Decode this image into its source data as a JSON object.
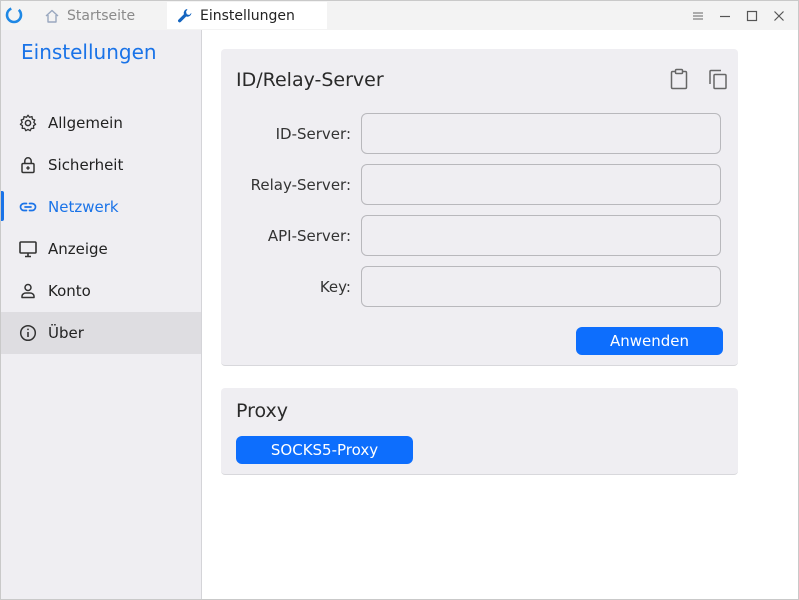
{
  "titlebar": {
    "tabs": [
      {
        "label": "Startseite",
        "icon": "home-icon"
      },
      {
        "label": "Einstellungen",
        "icon": "wrench-icon"
      }
    ],
    "controls": [
      "menu-icon",
      "minimize-icon",
      "maximize-icon",
      "close-icon"
    ]
  },
  "sidebar": {
    "title": "Einstellungen",
    "items": [
      {
        "label": "Allgemein",
        "icon": "gear-icon"
      },
      {
        "label": "Sicherheit",
        "icon": "lock-icon"
      },
      {
        "label": "Netzwerk",
        "icon": "link-icon",
        "active": true
      },
      {
        "label": "Anzeige",
        "icon": "monitor-icon"
      },
      {
        "label": "Konto",
        "icon": "user-icon"
      },
      {
        "label": "Über",
        "icon": "info-icon",
        "hovered": true
      }
    ]
  },
  "relay": {
    "title": "ID/Relay-Server",
    "fields": [
      {
        "label": "ID-Server:",
        "value": ""
      },
      {
        "label": "Relay-Server:",
        "value": ""
      },
      {
        "label": "API-Server:",
        "value": ""
      },
      {
        "label": "Key:",
        "value": ""
      }
    ],
    "apply_label": "Anwenden",
    "tools": [
      "clipboard-icon",
      "copy-icon"
    ]
  },
  "proxy": {
    "title": "Proxy",
    "socks_label": "SOCKS5-Proxy"
  },
  "colors": {
    "accent": "#1a73e8",
    "button": "#0d6efd",
    "sidebar_bg": "#efeef2",
    "card_bg": "#efeef2"
  }
}
